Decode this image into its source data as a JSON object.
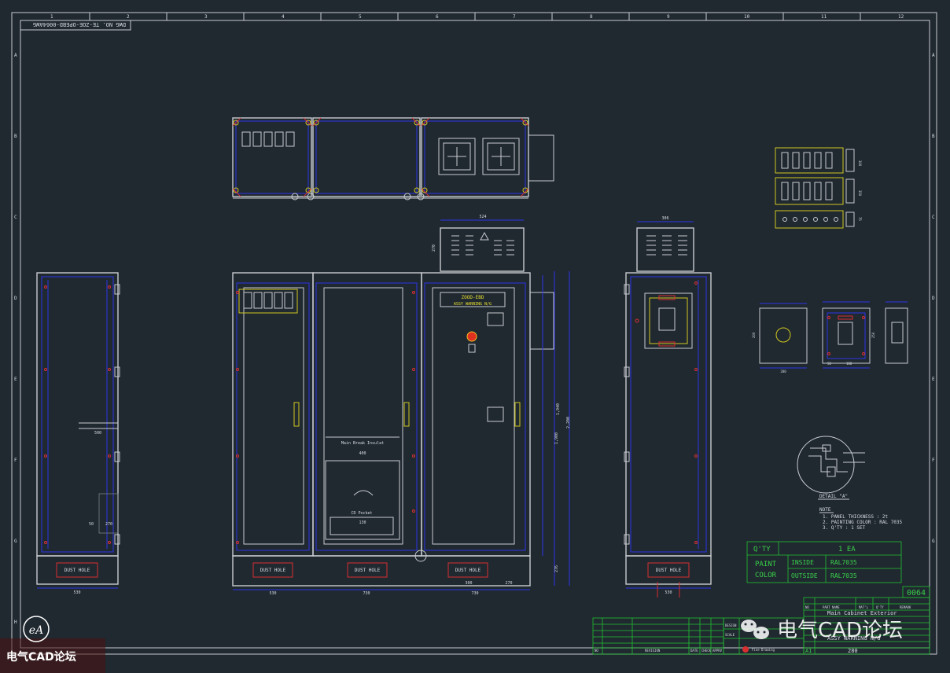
{
  "drawing": {
    "dwg_no": "DWG NO.  TE-ZOE-OPEBD-0064AWG",
    "col_numbers": [
      "1",
      "2",
      "3",
      "4",
      "5",
      "6",
      "7",
      "8",
      "9",
      "10",
      "11",
      "12"
    ],
    "row_letters": [
      "A",
      "B",
      "C",
      "D",
      "E",
      "F",
      "G",
      "H"
    ]
  },
  "front_view": {
    "door_label_1": "ZOOD-EBD",
    "door_label_2": "ASSY WARNING N/G",
    "inner_label_1": "Main Break Insulat",
    "inner_dim": "400",
    "pocket_label": "CD Pocket",
    "pocket_dim": "130",
    "gland_label": "DUST HOLE",
    "dims": {
      "top": "524",
      "roof": "270",
      "base": "276",
      "height_1": "1,940",
      "height_2": "2,200",
      "height_3": "1,900",
      "width_1": "530",
      "width_2": "730",
      "width_3": "300",
      "width_4": "730",
      "width_5": "270"
    }
  },
  "side_view_left": {
    "gland_label": "DUST HOLE",
    "dims": {
      "width": "530",
      "shelf": "500",
      "small_1": "50",
      "small_2": "270"
    }
  },
  "side_view_right": {
    "gland_label": "DUST HOLE",
    "dims": {
      "top": "306",
      "bottom": "530"
    }
  },
  "detail_views": {
    "top_dims": [
      "300",
      "350",
      "75"
    ],
    "box1_dims": {
      "w": "200",
      "h": "200"
    },
    "box2_dims": {
      "w": "180",
      "a": "50",
      "h": "250"
    },
    "detail_label": "DETAIL \"A\""
  },
  "notes": {
    "title": "NOTE",
    "items": [
      "1. PANEL THICKNESS : 2t",
      "2. PAINTING COLOR : RAL 7035",
      "3. Q'TY : 1 SET"
    ]
  },
  "paint_table": {
    "qty_label": "Q'TY",
    "qty_value": "1 EA",
    "paint_label_1": "PAINT",
    "paint_label_2": "COLOR",
    "inside_label": "INSIDE",
    "inside_value": "RAL7035",
    "outside_label": "OUTSIDE",
    "outside_value": "RAL7035"
  },
  "title_block": {
    "number": "0064",
    "part_name": "Main Cabinet Exterior",
    "assy": "ASSY WARNING N/G",
    "scale_value": "280",
    "rev_headers": [
      "NO",
      "REVISION",
      "DATE",
      "CHECK",
      "APPRV",
      "DESIGN",
      "SCALE"
    ],
    "company": "Fine Drawing",
    "code": "A1",
    "header_cols": [
      "NO",
      "PART NAME",
      "MAT'L",
      "Q'TY",
      "REMARK"
    ]
  },
  "watermark": {
    "text": "电气CAD论坛",
    "corner_text": "电气CAD论坛",
    "corner_logo": "eA"
  },
  "colors": {
    "background": "#202830",
    "white": "#c8ccd0",
    "blue": "#2d36e8",
    "red": "#d83030",
    "yellow": "#d0c820",
    "green": "#30c040"
  }
}
